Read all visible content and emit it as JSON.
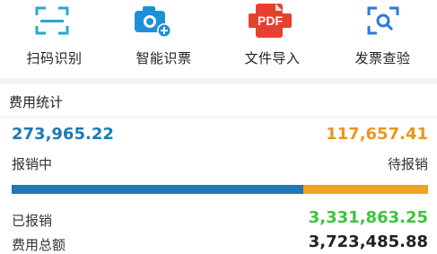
{
  "toolbar": {
    "items": [
      {
        "label": "扫码识别",
        "icon": "scan-icon"
      },
      {
        "label": "智能识票",
        "icon": "camera-icon"
      },
      {
        "label": "文件导入",
        "icon": "pdf-icon"
      },
      {
        "label": "发票查验",
        "icon": "search-scan-icon"
      }
    ]
  },
  "stats": {
    "title": "费用统计",
    "in_progress": {
      "value": "273,965.22",
      "label": "报销中"
    },
    "pending": {
      "value": "117,657.41",
      "label": "待报销"
    },
    "progress_fraction": 0.7,
    "reimbursed": {
      "label": "已报销",
      "value": "3,331,863.25"
    },
    "total": {
      "label": "费用总额",
      "value": "3,723,485.88"
    }
  },
  "colors": {
    "blue": "#1a7bb3",
    "orange": "#e8961e",
    "green": "#3cc43c",
    "pdf_red": "#e8402e"
  }
}
